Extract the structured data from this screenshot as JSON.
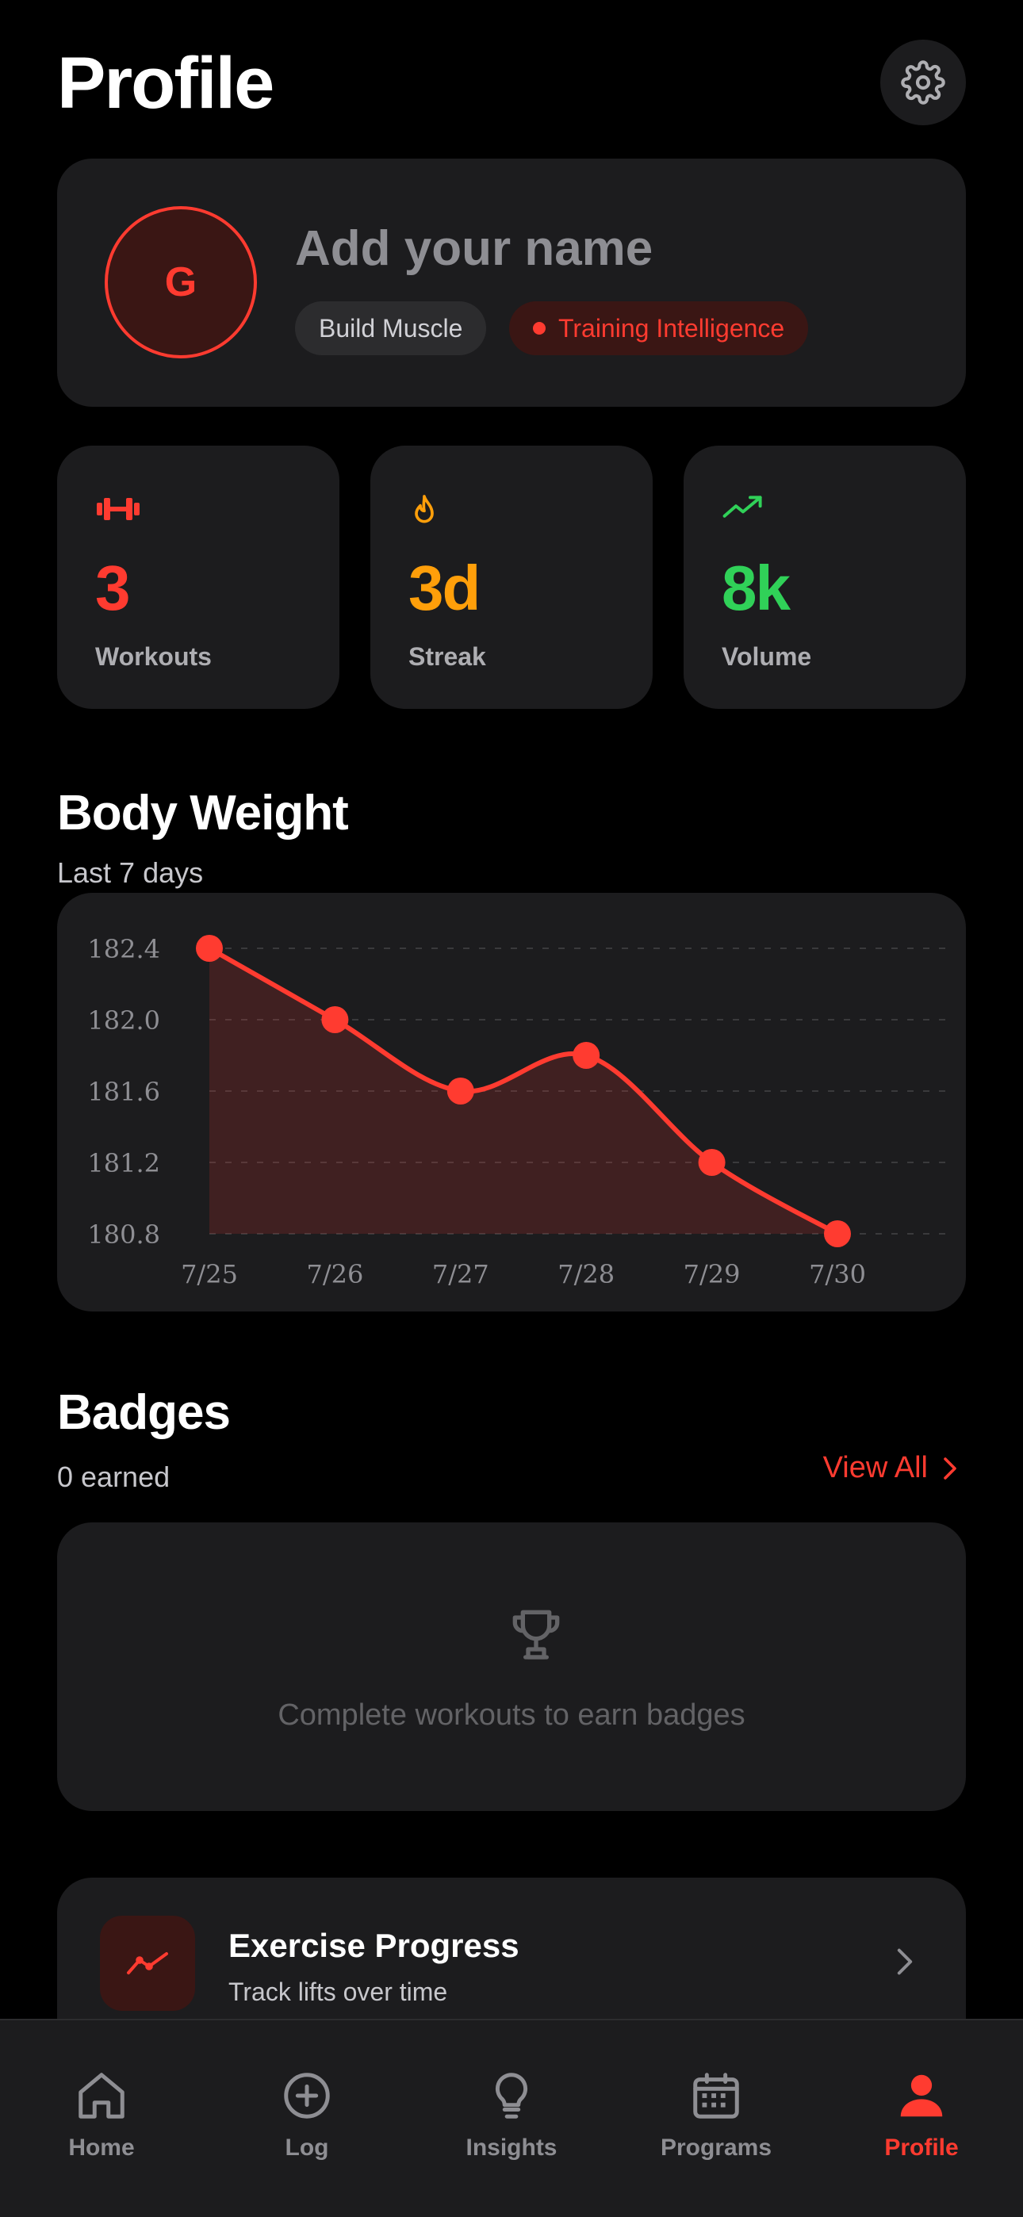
{
  "header": {
    "title": "Profile"
  },
  "profile": {
    "avatar_initial": "G",
    "name_placeholder": "Add your name",
    "goal_chip": "Build Muscle",
    "ti_chip": "Training Intelligence"
  },
  "stats": [
    {
      "value": "3",
      "label": "Workouts",
      "icon": "dumbbell-icon",
      "color": "#ff3b30"
    },
    {
      "value": "3d",
      "label": "Streak",
      "icon": "flame-icon",
      "color": "#ff9f0a"
    },
    {
      "value": "8k",
      "label": "Volume",
      "icon": "trending-up-icon",
      "color": "#30d158"
    }
  ],
  "body_weight": {
    "title": "Body Weight",
    "subtitle": "Last 7 days"
  },
  "chart_data": {
    "type": "area",
    "title": "",
    "xlabel": "",
    "ylabel": "",
    "categories": [
      "7/25",
      "7/26",
      "7/27",
      "7/28",
      "7/29",
      "7/30"
    ],
    "values": [
      182.4,
      182.0,
      181.6,
      181.8,
      181.2,
      180.8
    ],
    "yticks": [
      "182.4",
      "182.0",
      "181.6",
      "181.2",
      "180.8"
    ],
    "ylim": [
      180.8,
      182.4
    ],
    "grid": true,
    "color": "#ff3b30"
  },
  "badges": {
    "title": "Badges",
    "subtitle": "0 earned",
    "view_all": "View All",
    "empty_text": "Complete workouts to earn badges"
  },
  "exercise_progress": {
    "title": "Exercise Progress",
    "subtitle": "Track lifts over time"
  },
  "tabbar": [
    {
      "label": "Home",
      "icon": "home-icon"
    },
    {
      "label": "Log",
      "icon": "plus-circle-icon"
    },
    {
      "label": "Insights",
      "icon": "lightbulb-icon"
    },
    {
      "label": "Programs",
      "icon": "calendar-icon"
    },
    {
      "label": "Profile",
      "icon": "person-icon",
      "active": true
    }
  ]
}
